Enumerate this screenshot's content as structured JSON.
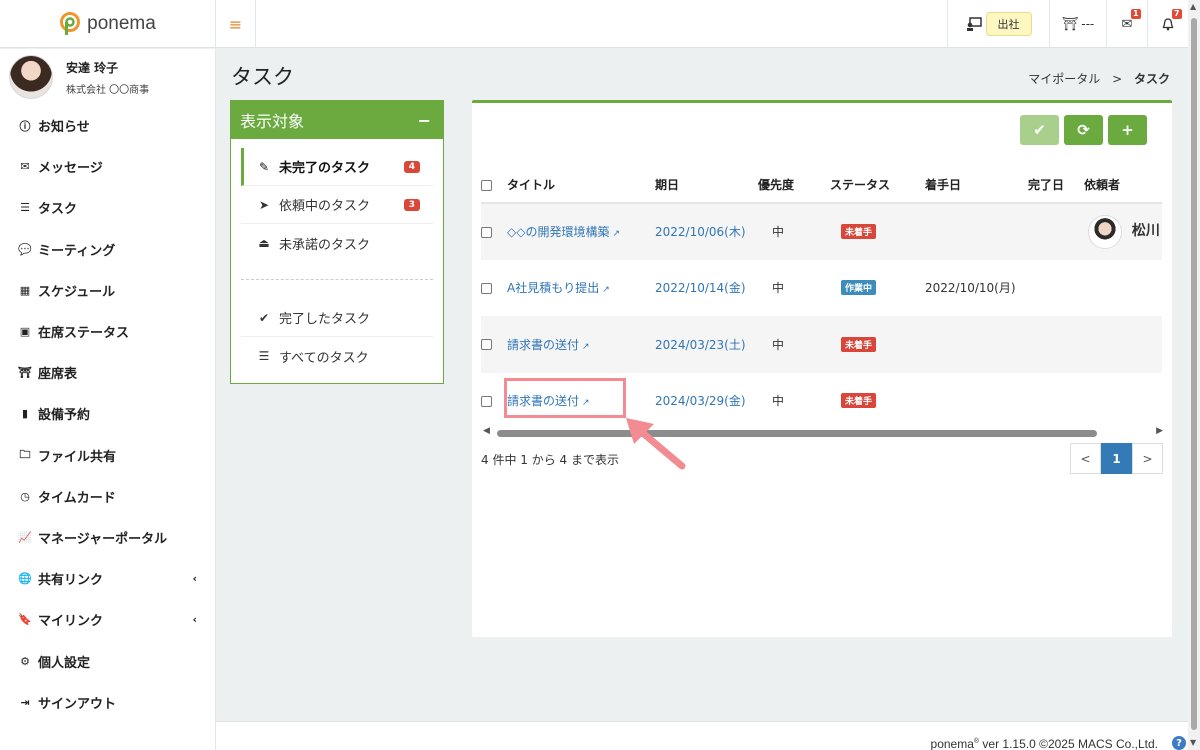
{
  "app": {
    "logo_text": "ponema",
    "hamburger": "≡"
  },
  "topbar": {
    "attendance_label": "出社",
    "seat_label": "---",
    "mail_count": "1",
    "bell_count": "7"
  },
  "user": {
    "name": "安達 玲子",
    "company": "株式会社 〇〇商事"
  },
  "sidebar": {
    "items": [
      {
        "label": "お知らせ",
        "icon": "info-circle-icon"
      },
      {
        "label": "メッセージ",
        "icon": "envelope-icon"
      },
      {
        "label": "タスク",
        "icon": "tasks-icon"
      },
      {
        "label": "ミーティング",
        "icon": "comments-icon"
      },
      {
        "label": "スケジュール",
        "icon": "calendar-icon"
      },
      {
        "label": "在席ステータス",
        "icon": "presence-icon"
      },
      {
        "label": "座席表",
        "icon": "seat-icon"
      },
      {
        "label": "設備予約",
        "icon": "door-icon"
      },
      {
        "label": "ファイル共有",
        "icon": "folder-icon"
      },
      {
        "label": "タイムカード",
        "icon": "clock-icon"
      },
      {
        "label": "マネージャーポータル",
        "icon": "chart-icon"
      },
      {
        "label": "共有リンク",
        "icon": "globe-icon"
      },
      {
        "label": "マイリンク",
        "icon": "bookmark-icon"
      },
      {
        "label": "個人設定",
        "icon": "gear-icon"
      },
      {
        "label": "サインアウト",
        "icon": "signout-icon"
      }
    ]
  },
  "page": {
    "title": "タスク",
    "breadcrumb_home": "マイポータル",
    "breadcrumb_sep": ">",
    "breadcrumb_current": "タスク"
  },
  "filter": {
    "heading": "表示対象",
    "collapse": "−",
    "items": [
      {
        "label": "未完了のタスク",
        "count": "4"
      },
      {
        "label": "依頼中のタスク",
        "count": "3"
      },
      {
        "label": "未承諾のタスク"
      },
      {
        "label": "完了したタスク"
      },
      {
        "label": "すべてのタスク"
      }
    ]
  },
  "table": {
    "headers": {
      "title": "タイトル",
      "due": "期日",
      "priority": "優先度",
      "status": "ステータス",
      "start": "着手日",
      "done": "完了日",
      "requester": "依頼者"
    },
    "rows": [
      {
        "title": "◇◇の開発環境構築",
        "due": "2022/10/06(木)",
        "priority": "中",
        "status": "未着手",
        "status_color": "#d9463a",
        "start": "",
        "done": "",
        "requester": "松川"
      },
      {
        "title": "A社見積もり提出",
        "due": "2022/10/14(金)",
        "priority": "中",
        "status": "作業中",
        "status_color": "#3c8dbc",
        "start": "2022/10/10(月)",
        "done": "",
        "requester": ""
      },
      {
        "title": "請求書の送付",
        "due": "2024/03/23(土)",
        "priority": "中",
        "status": "未着手",
        "status_color": "#d9463a",
        "start": "",
        "done": "",
        "requester": ""
      },
      {
        "title": "請求書の送付",
        "due": "2024/03/29(金)",
        "priority": "中",
        "status": "未着手",
        "status_color": "#d9463a",
        "start": "",
        "done": "",
        "requester": ""
      }
    ]
  },
  "summary": "4 件中 1 から 4 まで表示",
  "pager": {
    "prev": "<",
    "page": "1",
    "next": ">"
  },
  "footer": {
    "brand": "ponema",
    "reg": "®",
    "version": " ver 1.15.0 ©2025 MACS Co.,Ltd.",
    "help": "?"
  },
  "colors": {
    "accent": "#6aaa3f",
    "link": "#3176b7",
    "badge_red": "#d9463a",
    "badge_blue": "#3c8dbc",
    "highlight": "#f28b92"
  }
}
